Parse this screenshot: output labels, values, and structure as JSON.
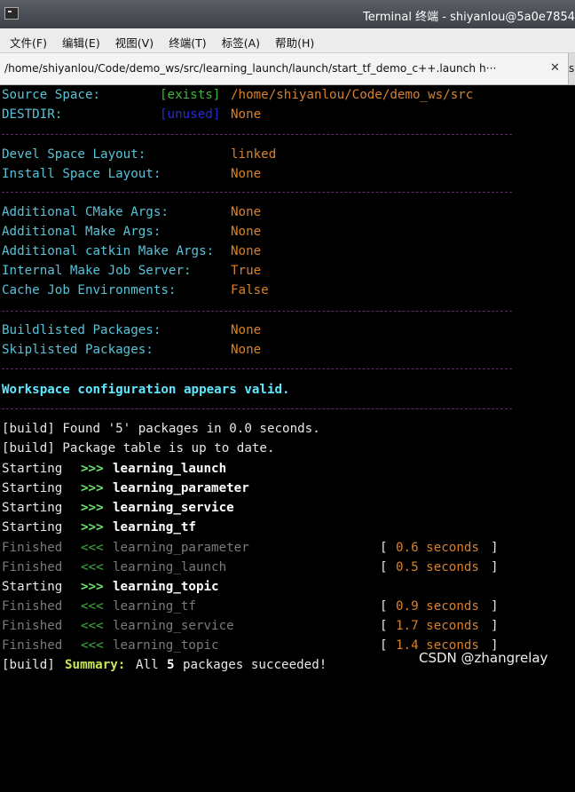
{
  "window": {
    "title": "Terminal 终端 - shiyanlou@5a0e7854"
  },
  "menu": [
    "文件(F)",
    "编辑(E)",
    "视图(V)",
    "终端(T)",
    "标签(A)",
    "帮助(H)"
  ],
  "tabs": {
    "active": "/home/shiyanlou/Code/demo_ws/src/learning_launch/launch/start_tf_demo_c++.launch h···",
    "close": "✕",
    "second": "s"
  },
  "config": {
    "source_label": "Source Space:",
    "source_tag": "[exists]",
    "source_value": "/home/shiyanlou/Code/demo_ws/src",
    "destdir_label": "DESTDIR:",
    "destdir_tag": "[unused]",
    "destdir_value": "None",
    "devel_label": "Devel Space Layout:",
    "devel_value": "linked",
    "install_label": "Install Space Layout:",
    "install_value": "None",
    "cmake_label": "Additional CMake Args:",
    "cmake_value": "None",
    "make_label": "Additional Make Args:",
    "make_value": "None",
    "catkin_label": "Additional catkin Make Args:",
    "catkin_value": "None",
    "jobserver_label": "Internal Make Job Server:",
    "jobserver_value": "True",
    "cachejob_label": "Cache Job Environments:",
    "cachejob_value": "False",
    "buildlisted_label": "Buildlisted Packages:",
    "buildlisted_value": "None",
    "skiplisted_label": "Skiplisted Packages:",
    "skiplisted_value": "None",
    "valid_msg": "Workspace configuration appears valid."
  },
  "build": {
    "found": "[build] Found '5' packages in 0.0 seconds.",
    "table": "[build] Package table is up to date.",
    "starting": "Starting",
    "finished": "Finished",
    "start_arrow": ">>>",
    "finish_arrow": "<<<",
    "pkg_launch": "learning_launch",
    "pkg_parameter": "learning_parameter",
    "pkg_service": "learning_service",
    "pkg_tf": "learning_tf",
    "pkg_topic": "learning_topic",
    "time_parameter": "0.6 seconds",
    "time_launch": "0.5 seconds",
    "time_tf": "0.9 seconds",
    "time_service": "1.7 seconds",
    "time_topic": "1.4 seconds",
    "lbr": "[",
    "rbr": "]",
    "summary_prefix": "[build]",
    "summary_word": "Summary:",
    "summary_all": "All",
    "summary_count": "5",
    "summary_rest": "packages succeeded!"
  },
  "watermark": "CSDN @zhangrelay"
}
